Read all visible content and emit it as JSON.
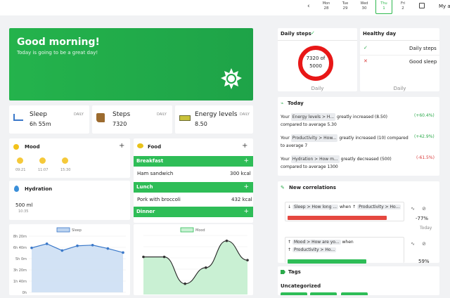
{
  "calendar": {
    "days": [
      {
        "name": "Mon",
        "num": "28"
      },
      {
        "name": "Tue",
        "num": "29"
      },
      {
        "name": "Wed",
        "num": "30"
      },
      {
        "name": "Thu",
        "num": "1"
      },
      {
        "name": "Fri",
        "num": "2"
      }
    ],
    "selected_index": 3,
    "menu_label": "My a"
  },
  "greeting": {
    "title": "Good morning!",
    "subtitle": "Today is going to be a great day!"
  },
  "metrics": [
    {
      "label": "Sleep",
      "value": "6h 55m",
      "badge": "DAILY",
      "icon": "bed-icon"
    },
    {
      "label": "Steps",
      "value": "7320",
      "badge": "DAILY",
      "icon": "boot-icon"
    },
    {
      "label": "Energy levels",
      "value": "8.50",
      "badge": "DAILY",
      "icon": "battery-icon"
    }
  ],
  "mood": {
    "title": "Mood",
    "entries": [
      {
        "time": "09:21",
        "face": "sad"
      },
      {
        "time": "11:07",
        "face": "sad"
      },
      {
        "time": "15:30",
        "face": "happy"
      }
    ]
  },
  "hydration": {
    "title": "Hydration",
    "value": "500 ml",
    "time": "10:35"
  },
  "food": {
    "title": "Food",
    "breakfast": "Breakfast",
    "lunch": "Lunch",
    "dinner": "Dinner",
    "items": [
      {
        "name": "Ham sandwich",
        "kcal": "300 kcal"
      },
      {
        "name": "Pork with broccoli",
        "kcal": "432 kcal"
      }
    ]
  },
  "sleep_chart": {
    "legend": "Sleep",
    "ticks": [
      "8h 20m",
      "6h 40m",
      "5h 0m",
      "3h 20m",
      "1h 40m",
      "0h"
    ],
    "color": "#3a78c9"
  },
  "chart_data": [
    {
      "type": "area",
      "series": [
        {
          "name": "Sleep",
          "values": [
            6.6,
            7.2,
            6.2,
            6.9,
            7.0,
            6.5,
            5.9
          ]
        }
      ],
      "ylim": [
        0,
        8.33
      ],
      "ylabel": "",
      "xlabel": ""
    },
    {
      "type": "line",
      "series": [
        {
          "name": "Mood",
          "values": [
            3.5,
            3.5,
            1.0,
            2.5,
            5.0,
            3.2
          ]
        }
      ],
      "ylim": [
        0,
        5.5
      ]
    }
  ],
  "steps_card": {
    "title": "Daily steps",
    "value": "7320 of 5000",
    "footer": "Daily"
  },
  "healthy_day": {
    "title": "Healthy day",
    "items": [
      {
        "status": "check",
        "label": "Daily steps"
      },
      {
        "status": "cross",
        "label": "Good sleep"
      }
    ],
    "footer": "Daily"
  },
  "today": {
    "title": "Today",
    "rows": [
      {
        "prefix": "Your",
        "chip": "Energy levels > H...",
        "text": "greatly increased (8.50)",
        "text2": "compared to average 5.30",
        "delta": "(+60.4%)",
        "positive": true
      },
      {
        "prefix": "Your",
        "chip": "Productivity > How...",
        "text": "greatly increased (10) compared",
        "text2": "to average 7",
        "delta": "(+42.9%)",
        "positive": true
      },
      {
        "prefix": "Your",
        "chip": "Hydration > How m...",
        "text": "greatly decreased (500)",
        "text2": "compared to average 1300",
        "delta": "(-61.5%)",
        "positive": false
      }
    ]
  },
  "correlations": {
    "title": "New correlations",
    "items": [
      {
        "left": "Sleep > How long ...",
        "when": "when",
        "right": "Productivity > Ho...",
        "value": "-77%",
        "bar_fraction": 0.88,
        "bar_color": "#e5473f",
        "time": "Today"
      },
      {
        "left": "Mood > How are yo...",
        "when": "when",
        "right": "Productivity > Ho...",
        "value": "59%",
        "bar_fraction": 0.7,
        "bar_color": "#2ebd57",
        "time": ""
      }
    ]
  },
  "tags": {
    "title": "Tags",
    "group": "Uncategorized"
  }
}
